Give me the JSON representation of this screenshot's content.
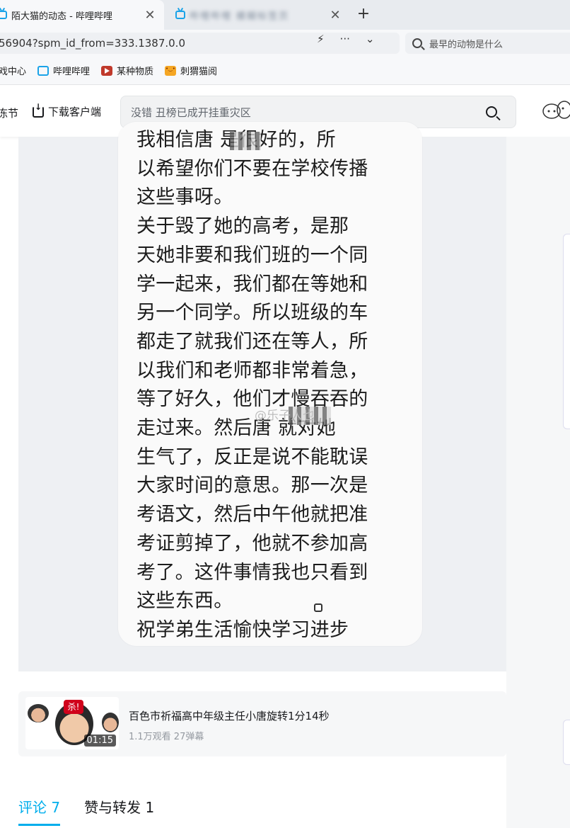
{
  "browser": {
    "tabs": [
      {
        "title": "陌大猫的动态 - 哔哩哔哩",
        "active": true
      },
      {
        "title": "哔哩哔哩 模糊标签页",
        "active": false
      }
    ],
    "close_glyph": "✕",
    "new_tab_glyph": "+",
    "url": "56904?spm_id_from=333.1387.0.0",
    "url_actions": [
      "⚡",
      "···",
      "⌄"
    ],
    "search_placeholder": "最早的动物是什么",
    "bookmarks": [
      "戏中心",
      "哔哩哔哩",
      "某种物质",
      "刺猬猫阅"
    ]
  },
  "site_header": {
    "festival_label": "冻节",
    "download_label": "下载客户端",
    "search_placeholder": "没错 丑榜已成开挂重灾区"
  },
  "message": {
    "text": "我相信唐     是很好的，所\n以希望你们不要在学校传播\n这些事呀。\n  关于毁了她的高考，是那\n天她非要和我们班的一个同\n学一起来，我们都在等她和\n另一个同学。所以班级的车\n都走了就我们还在等人，所\n以我们和老师都非常着急，\n等了好久，他们才慢吞吞的\n走过来。然后唐     就对她\n生气了，反正是说不能耽误\n大家时间的意思。那一次是\n考语文，然后中午他就把准\n考证剪掉了，他就不参加高\n考了。这件事情我也只看到\n这些东西。\n祝学弟生活愉快学习进步",
    "watermark": "@乐子人也"
  },
  "related_video": {
    "title": "百色市祈福高中年级主任小唐旋转1分14秒",
    "stats": "1.1万观看 27弹幕",
    "duration": "01:15",
    "tag": "杀!"
  },
  "comment_tabs": [
    {
      "label": "评论 7",
      "active": true
    },
    {
      "label": "赞与转发 1",
      "active": false
    }
  ],
  "colors": {
    "accent": "#00aeec",
    "tab_icon": "#1aa3e8"
  }
}
